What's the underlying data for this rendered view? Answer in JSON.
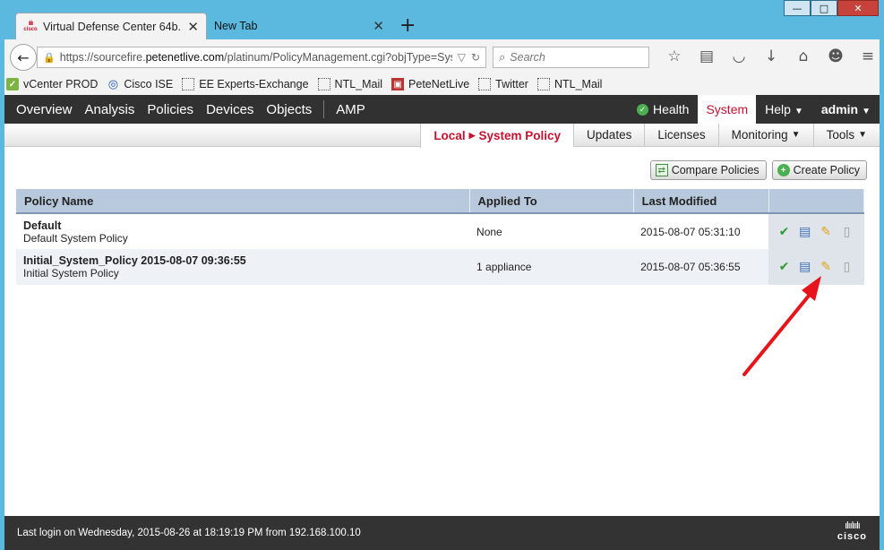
{
  "browser": {
    "tabs": [
      {
        "label": "Virtual Defense Center 64b...",
        "favicon_text": "cisco"
      },
      {
        "label": "New Tab"
      }
    ],
    "window_buttons": {
      "minimize": "—",
      "maximize": "□",
      "close": "✕"
    },
    "url": {
      "prefix": "https://sourcefire.",
      "domain": "petenetlive.com",
      "path": "/platinum/PolicyManagement.cgi?objType=Sys"
    },
    "search_placeholder": "Search",
    "bookmarks": [
      "vCenter PROD",
      "Cisco ISE",
      "EE Experts-Exchange",
      "NTL_Mail",
      "PeteNetLive",
      "Twitter",
      "NTL_Mail"
    ]
  },
  "nav": {
    "items": [
      "Overview",
      "Analysis",
      "Policies",
      "Devices",
      "Objects",
      "AMP"
    ],
    "health": "Health",
    "system": "System",
    "help": "Help",
    "user": "admin"
  },
  "subnav": {
    "active_prefix": "Local",
    "active_label": "System Policy",
    "items": [
      "Updates",
      "Licenses",
      "Monitoring",
      "Tools"
    ]
  },
  "actions": {
    "compare": "Compare Policies",
    "create": "Create Policy"
  },
  "table": {
    "headers": [
      "Policy Name",
      "Applied To",
      "Last Modified"
    ],
    "rows": [
      {
        "name": "Default",
        "description": "Default System Policy",
        "applied_to": "None",
        "modified": "2015-08-07 05:31:10"
      },
      {
        "name": "Initial_System_Policy 2015-08-07 09:36:55",
        "description": "Initial System Policy",
        "applied_to": "1 appliance",
        "modified": "2015-08-07 05:36:55"
      }
    ]
  },
  "footer": {
    "last_login": "Last login on Wednesday, 2015-08-26 at 18:19:19 PM from 192.168.100.10",
    "logo_text": "cisco"
  },
  "colors": {
    "accent_red": "#c8102e",
    "nav_bg": "#313131",
    "header_blue": "#b8c9dd"
  }
}
